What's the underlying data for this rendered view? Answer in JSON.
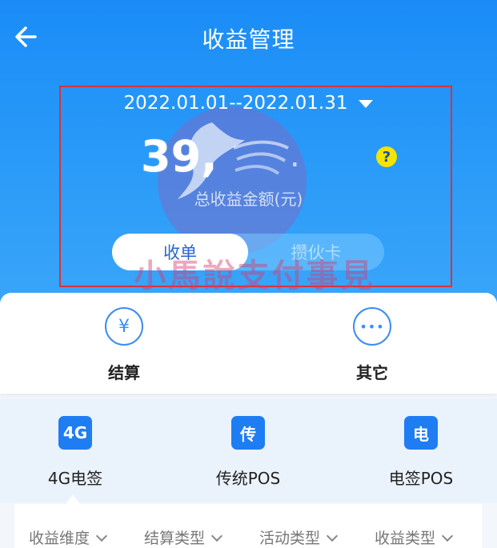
{
  "header": {
    "title": "收益管理",
    "date_range": "2022.01.01--2022.01.31",
    "amount": "39,",
    "amount_tail": ".",
    "amount_label": "总收益金额(元)",
    "help_glyph": "?",
    "toggle": {
      "active": "收单",
      "inactive": "攒伙卡"
    }
  },
  "watermark": "小馬說支付事見",
  "actions": [
    {
      "label": "结算",
      "icon": "yen-icon",
      "glyph": "¥"
    },
    {
      "label": "其它",
      "icon": "more-icon",
      "glyph": "•••"
    }
  ],
  "types": [
    {
      "badge": "4G",
      "label": "4G电签"
    },
    {
      "badge": "传",
      "label": "传统POS"
    },
    {
      "badge": "电",
      "label": "电签POS"
    }
  ],
  "filters": [
    "收益维度",
    "结算类型",
    "活动类型",
    "收益类型"
  ],
  "colors": {
    "header_blue": "#1b8cf7",
    "accent": "#1e7df2",
    "box_red": "#d9323b",
    "help_yellow": "#f5e300"
  }
}
